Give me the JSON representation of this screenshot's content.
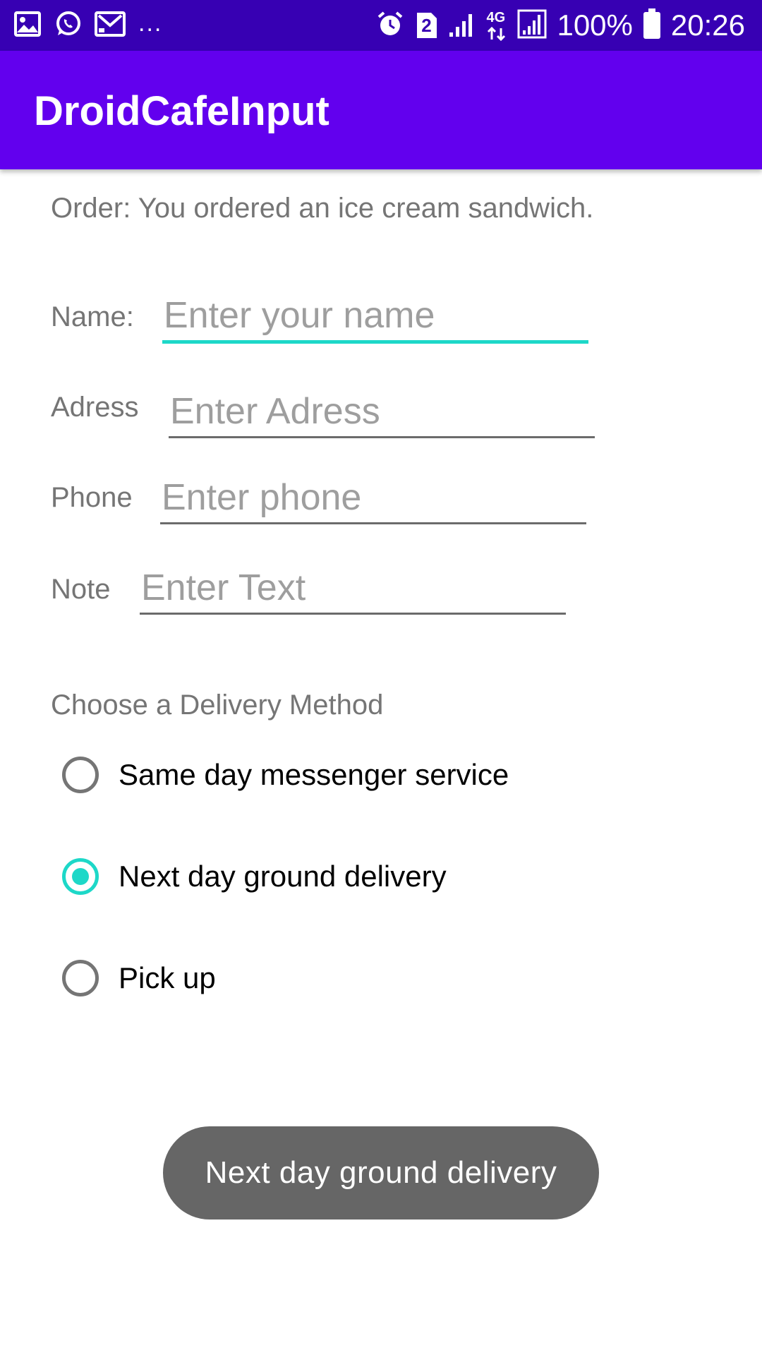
{
  "status_bar": {
    "left_icons": [
      "image-icon",
      "whatsapp-icon",
      "mail-icon"
    ],
    "overflow": "...",
    "right_icons": [
      "alarm-icon",
      "sim-2-icon",
      "signal-icon",
      "4g-icon",
      "signal-full-icon"
    ],
    "sim_number": "2",
    "network": "4G",
    "battery_percent": "100%",
    "time": "20:26"
  },
  "app_bar": {
    "title": "DroidCafeInput"
  },
  "order": {
    "text": "Order: You ordered an ice cream sandwich."
  },
  "form": {
    "name": {
      "label": "Name:",
      "placeholder": "Enter your name",
      "value": ""
    },
    "address": {
      "label": "Adress",
      "placeholder": "Enter Adress",
      "value": ""
    },
    "phone": {
      "label": "Phone",
      "placeholder": "Enter phone",
      "value": ""
    },
    "note": {
      "label": "Note",
      "placeholder": "Enter Text",
      "value": ""
    }
  },
  "delivery": {
    "heading": "Choose a Delivery Method",
    "options": [
      {
        "label": "Same day messenger service",
        "checked": false
      },
      {
        "label": "Next day ground delivery",
        "checked": true
      },
      {
        "label": "Pick up",
        "checked": false
      }
    ]
  },
  "toast": {
    "message": "Next day ground delivery"
  },
  "colors": {
    "status_bar": "#3700b3",
    "app_bar": "#6200ee",
    "accent": "#1dd8c8",
    "toast_bg": "#666666"
  }
}
